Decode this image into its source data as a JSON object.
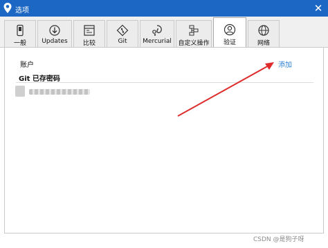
{
  "window": {
    "title": "选项",
    "icon": "location-pin-icon",
    "close": "✕"
  },
  "tabs": [
    {
      "label": "一般",
      "icon": "phone-icon"
    },
    {
      "label": "Updates",
      "icon": "download-arrow-icon"
    },
    {
      "label": "比较",
      "icon": "compare-icon"
    },
    {
      "label": "Git",
      "icon": "git-diamond-icon"
    },
    {
      "label": "Mercurial",
      "icon": "mercurial-icon"
    },
    {
      "label": "自定义操作",
      "icon": "custom-actions-icon"
    },
    {
      "label": "验证",
      "icon": "user-circle-icon",
      "active": true
    },
    {
      "label": "网络",
      "icon": "globe-icon"
    }
  ],
  "panel": {
    "accounts_label": "账户",
    "add_link": "添加",
    "saved_title": "Git 已存密码"
  },
  "watermark": "CSDN @是狗子呀",
  "colors": {
    "titlebar": "#1b67c3",
    "link": "#2c7fd8",
    "annotation_arrow": "#e02b2b"
  }
}
